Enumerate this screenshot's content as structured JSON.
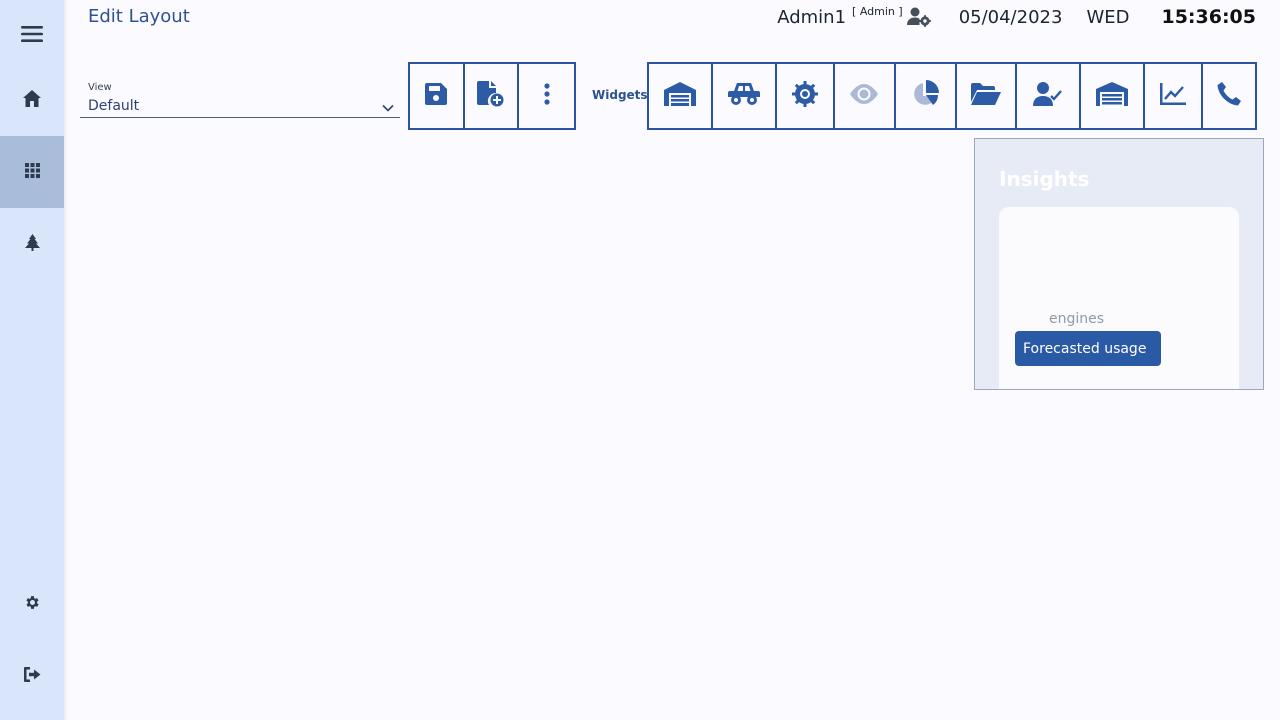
{
  "page": {
    "title": "Edit Layout"
  },
  "header": {
    "user_name": "Admin1",
    "user_role": "[ Admin ]",
    "user_icon": "user-gear-icon",
    "date": "05/04/2023",
    "weekday": "WED",
    "time": "15:36:05"
  },
  "sidebar": {
    "items": [
      {
        "icon": "menu-icon"
      },
      {
        "icon": "home-icon"
      },
      {
        "icon": "grid-icon",
        "active": true
      },
      {
        "icon": "tree-icon"
      },
      {
        "icon": "gear-icon"
      },
      {
        "icon": "logout-icon"
      }
    ]
  },
  "view": {
    "label": "View",
    "value": "Default"
  },
  "toolbar": {
    "actions": [
      "save-icon",
      "add-file-icon",
      "more-vertical-icon"
    ],
    "widgets_label": "Widgets",
    "widgets": [
      "hangar-icon",
      "vehicle-icon",
      "cog-icon",
      "eye-icon",
      "pie-chart-icon",
      "folder-open-icon",
      "user-check-icon",
      "warehouse-icon",
      "line-chart-icon",
      "phone-icon"
    ]
  },
  "insights": {
    "title": "Insights",
    "engines_label": "engines",
    "forecast_button": "Forecasted usage"
  },
  "colors": {
    "accent": "#2d5ba6",
    "sidebar_bg": "#d8e5fb",
    "sidebar_active": "#a9bcd9",
    "page_bg": "#fbfaff"
  }
}
